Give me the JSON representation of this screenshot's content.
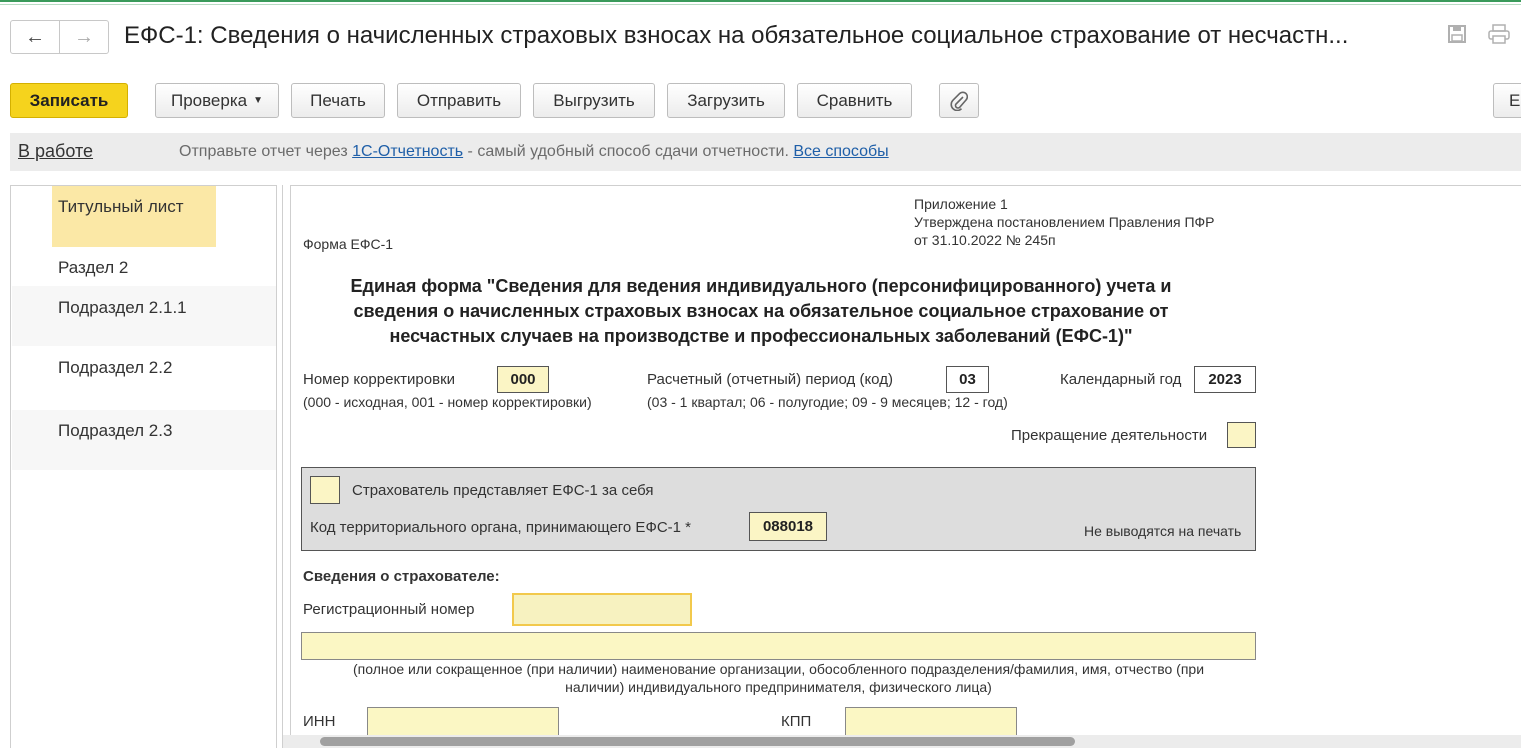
{
  "window": {
    "title": "ЕФС-1: Сведения о начисленных страховых взносах на обязательное социальное страхование от несчастн..."
  },
  "nav": {
    "back": "←",
    "forward": "→"
  },
  "toolbar": {
    "save": "Записать",
    "check": "Проверка",
    "print": "Печать",
    "send": "Отправить",
    "export": "Выгрузить",
    "import": "Загрузить",
    "compare": "Сравнить",
    "more_fragment": "Е"
  },
  "infobar": {
    "status": "В работе",
    "text_before": "Отправьте отчет через ",
    "link1": "1С-Отчетность",
    "text_middle": " - самый удобный способ сдачи отчетности. ",
    "link2": "Все способы"
  },
  "sidebar": {
    "items": [
      {
        "label": "Титульный лист"
      },
      {
        "label": "Раздел 2"
      },
      {
        "label": "Подраздел 2.1.1"
      },
      {
        "label": "Подраздел 2.2"
      },
      {
        "label": "Подраздел 2.3"
      }
    ]
  },
  "form": {
    "appendix_line1": "Приложение 1",
    "appendix_line2": "Утверждена постановлением Правления ПФР",
    "appendix_line3": "от 31.10.2022 № 245п",
    "form_label": "Форма ЕФС-1",
    "heading_line1": "Единая форма \"Сведения для ведения индивидуального (персонифицированного) учета и",
    "heading_line2": "сведения о начисленных страховых взносах на обязательное социальное страхование от",
    "heading_line3": "несчастных случаев на производстве и профессиональных заболеваний (ЕФС-1)\"",
    "correction_label": "Номер корректировки",
    "correction_value": "000",
    "correction_hint": "(000 - исходная, 001 - номер корректировки)",
    "period_label": "Расчетный (отчетный) период (код)",
    "period_value": "03",
    "period_hint": "(03 - 1 квартал; 06 - полугодие; 09 - 9 месяцев; 12 - год)",
    "year_label": "Календарный год",
    "year_value": "2023",
    "termination_label": "Прекращение деятельности",
    "self_label": "Страхователь представляет ЕФС-1 за себя",
    "territory_label": "Код территориального органа, принимающего ЕФС-1 *",
    "territory_value": "088018",
    "no_print": "Не выводятся на печать",
    "insurer_heading": "Сведения о страхователе:",
    "reg_number_label": "Регистрационный номер",
    "name_hint_line1": "(полное или сокращенное (при наличии) наименование организации, обособленного подразделения/фамилия, имя, отчество (при",
    "name_hint_line2": "наличии) индивидуального предпринимателя, физического лица)",
    "inn_label": "ИНН",
    "kpp_label": "КПП"
  }
}
